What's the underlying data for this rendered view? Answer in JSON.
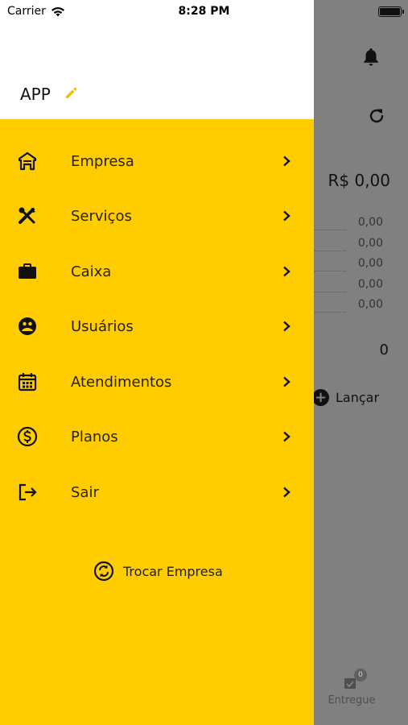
{
  "status_bar": {
    "carrier": "Carrier",
    "time": "8:28 PM"
  },
  "drawer": {
    "app_name": "APP",
    "menu": [
      {
        "label": "Empresa",
        "icon": "building-icon"
      },
      {
        "label": "Serviços",
        "icon": "tools-icon"
      },
      {
        "label": "Caixa",
        "icon": "briefcase-icon"
      },
      {
        "label": "Usuários",
        "icon": "users-icon"
      },
      {
        "label": "Atendimentos",
        "icon": "calendar-icon"
      },
      {
        "label": "Planos",
        "icon": "dollar-icon"
      },
      {
        "label": "Sair",
        "icon": "logout-icon"
      }
    ],
    "switch_company_label": "Trocar Empresa"
  },
  "background": {
    "total": "R$ 0,00",
    "values": [
      "0,00",
      "0,00",
      "0,00",
      "0,00",
      "0,00"
    ],
    "count": "0",
    "launch_label": "Lançar",
    "tab_entregue_label": "Entregue",
    "tab_entregue_badge": "0"
  },
  "colors": {
    "accent": "#ffcc00",
    "overlay": "#808080",
    "text": "#2a2400"
  }
}
